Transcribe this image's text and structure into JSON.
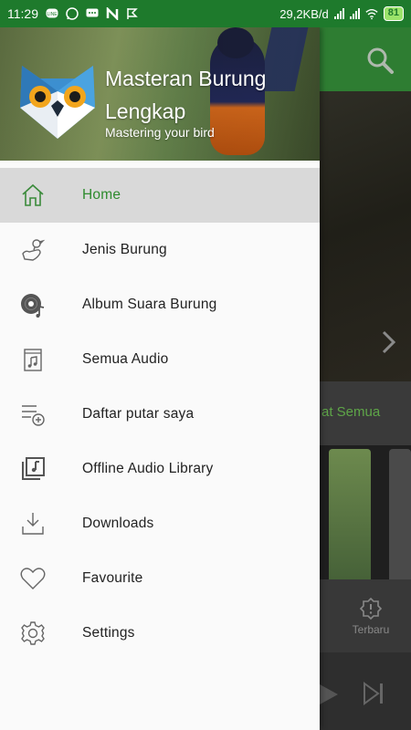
{
  "status_bar": {
    "time": "11:29",
    "network_speed": "29,2KB/d",
    "battery": "81"
  },
  "background": {
    "see_all_partial": "at Semua",
    "nav_item_label": "Terbaru"
  },
  "drawer": {
    "app_name": "Masteran Burung Lengkap",
    "tagline": "Mastering your bird",
    "menu": [
      {
        "label": "Home",
        "icon": "home-icon",
        "active": true
      },
      {
        "label": "Jenis Burung",
        "icon": "hand-bird-icon",
        "active": false
      },
      {
        "label": "Album Suara Burung",
        "icon": "vinyl-album-icon",
        "active": false
      },
      {
        "label": "Semua Audio",
        "icon": "audio-file-icon",
        "active": false
      },
      {
        "label": "Daftar putar saya",
        "icon": "playlist-add-icon",
        "active": false
      },
      {
        "label": "Offline Audio Library",
        "icon": "music-library-icon",
        "active": false
      },
      {
        "label": "Downloads",
        "icon": "download-icon",
        "active": false
      },
      {
        "label": "Favourite",
        "icon": "heart-icon",
        "active": false
      },
      {
        "label": "Settings",
        "icon": "gear-icon",
        "active": false
      }
    ]
  },
  "colors": {
    "accent": "#2e8b2e",
    "toolbar": "#2e7d32",
    "status_bar": "#1e7a2c"
  }
}
